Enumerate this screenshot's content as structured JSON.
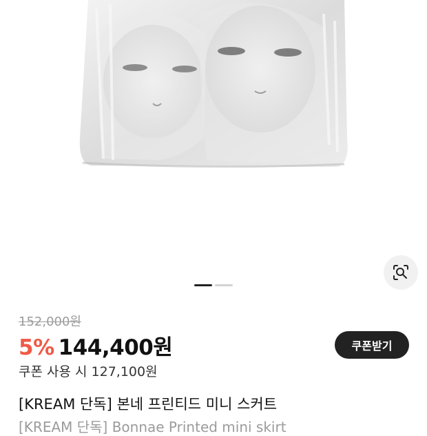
{
  "product": {
    "original_price": "152,000원",
    "discount": "5%",
    "sale_price": "144,400원",
    "coupon_button_label": "쿠폰받기",
    "coupon_price": "쿠폰 사용 시 127,100원",
    "title_ko": "[KREAM 단독] 본네 프린티드 미니 스커트",
    "title_en": "[KREAM 단독] Bonnae Printed mini skirt"
  },
  "gallery": {
    "image_alt": "printed mini skirt with doll faces",
    "lens_icon": "lens-search-icon",
    "page_count": 2,
    "current_page": 1
  },
  "colors": {
    "discount": "#ef5a47",
    "button_bg": "#222222",
    "muted_text": "#9b9b9b"
  }
}
